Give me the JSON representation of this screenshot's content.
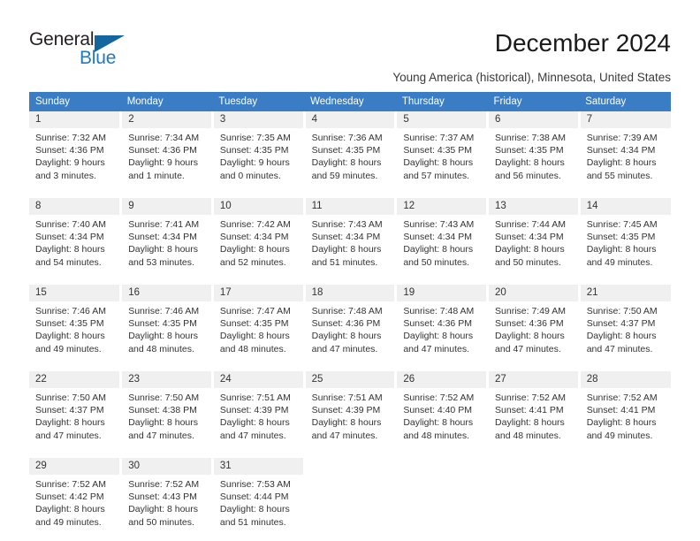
{
  "brand": {
    "name_top": "General",
    "name_bottom": "Blue",
    "color_top": "#231f20",
    "color_bottom": "#1f7ac4",
    "triangle_color": "#15669e"
  },
  "header": {
    "month_title": "December 2024",
    "location": "Young America (historical), Minnesota, United States",
    "header_bg": "#3b7dc4",
    "header_text_color": "#ffffff"
  },
  "weekday_headers": [
    "Sunday",
    "Monday",
    "Tuesday",
    "Wednesday",
    "Thursday",
    "Friday",
    "Saturday"
  ],
  "labels": {
    "sunrise_prefix": "Sunrise:",
    "sunset_prefix": "Sunset:",
    "daylight_prefix": "Daylight:"
  },
  "weeks": [
    [
      {
        "day": "1",
        "sunrise": "Sunrise: 7:32 AM",
        "sunset": "Sunset: 4:36 PM",
        "daylight_line1": "Daylight: 9 hours",
        "daylight_line2": "and 3 minutes."
      },
      {
        "day": "2",
        "sunrise": "Sunrise: 7:34 AM",
        "sunset": "Sunset: 4:36 PM",
        "daylight_line1": "Daylight: 9 hours",
        "daylight_line2": "and 1 minute."
      },
      {
        "day": "3",
        "sunrise": "Sunrise: 7:35 AM",
        "sunset": "Sunset: 4:35 PM",
        "daylight_line1": "Daylight: 9 hours",
        "daylight_line2": "and 0 minutes."
      },
      {
        "day": "4",
        "sunrise": "Sunrise: 7:36 AM",
        "sunset": "Sunset: 4:35 PM",
        "daylight_line1": "Daylight: 8 hours",
        "daylight_line2": "and 59 minutes."
      },
      {
        "day": "5",
        "sunrise": "Sunrise: 7:37 AM",
        "sunset": "Sunset: 4:35 PM",
        "daylight_line1": "Daylight: 8 hours",
        "daylight_line2": "and 57 minutes."
      },
      {
        "day": "6",
        "sunrise": "Sunrise: 7:38 AM",
        "sunset": "Sunset: 4:35 PM",
        "daylight_line1": "Daylight: 8 hours",
        "daylight_line2": "and 56 minutes."
      },
      {
        "day": "7",
        "sunrise": "Sunrise: 7:39 AM",
        "sunset": "Sunset: 4:34 PM",
        "daylight_line1": "Daylight: 8 hours",
        "daylight_line2": "and 55 minutes."
      }
    ],
    [
      {
        "day": "8",
        "sunrise": "Sunrise: 7:40 AM",
        "sunset": "Sunset: 4:34 PM",
        "daylight_line1": "Daylight: 8 hours",
        "daylight_line2": "and 54 minutes."
      },
      {
        "day": "9",
        "sunrise": "Sunrise: 7:41 AM",
        "sunset": "Sunset: 4:34 PM",
        "daylight_line1": "Daylight: 8 hours",
        "daylight_line2": "and 53 minutes."
      },
      {
        "day": "10",
        "sunrise": "Sunrise: 7:42 AM",
        "sunset": "Sunset: 4:34 PM",
        "daylight_line1": "Daylight: 8 hours",
        "daylight_line2": "and 52 minutes."
      },
      {
        "day": "11",
        "sunrise": "Sunrise: 7:43 AM",
        "sunset": "Sunset: 4:34 PM",
        "daylight_line1": "Daylight: 8 hours",
        "daylight_line2": "and 51 minutes."
      },
      {
        "day": "12",
        "sunrise": "Sunrise: 7:43 AM",
        "sunset": "Sunset: 4:34 PM",
        "daylight_line1": "Daylight: 8 hours",
        "daylight_line2": "and 50 minutes."
      },
      {
        "day": "13",
        "sunrise": "Sunrise: 7:44 AM",
        "sunset": "Sunset: 4:34 PM",
        "daylight_line1": "Daylight: 8 hours",
        "daylight_line2": "and 50 minutes."
      },
      {
        "day": "14",
        "sunrise": "Sunrise: 7:45 AM",
        "sunset": "Sunset: 4:35 PM",
        "daylight_line1": "Daylight: 8 hours",
        "daylight_line2": "and 49 minutes."
      }
    ],
    [
      {
        "day": "15",
        "sunrise": "Sunrise: 7:46 AM",
        "sunset": "Sunset: 4:35 PM",
        "daylight_line1": "Daylight: 8 hours",
        "daylight_line2": "and 49 minutes."
      },
      {
        "day": "16",
        "sunrise": "Sunrise: 7:46 AM",
        "sunset": "Sunset: 4:35 PM",
        "daylight_line1": "Daylight: 8 hours",
        "daylight_line2": "and 48 minutes."
      },
      {
        "day": "17",
        "sunrise": "Sunrise: 7:47 AM",
        "sunset": "Sunset: 4:35 PM",
        "daylight_line1": "Daylight: 8 hours",
        "daylight_line2": "and 48 minutes."
      },
      {
        "day": "18",
        "sunrise": "Sunrise: 7:48 AM",
        "sunset": "Sunset: 4:36 PM",
        "daylight_line1": "Daylight: 8 hours",
        "daylight_line2": "and 47 minutes."
      },
      {
        "day": "19",
        "sunrise": "Sunrise: 7:48 AM",
        "sunset": "Sunset: 4:36 PM",
        "daylight_line1": "Daylight: 8 hours",
        "daylight_line2": "and 47 minutes."
      },
      {
        "day": "20",
        "sunrise": "Sunrise: 7:49 AM",
        "sunset": "Sunset: 4:36 PM",
        "daylight_line1": "Daylight: 8 hours",
        "daylight_line2": "and 47 minutes."
      },
      {
        "day": "21",
        "sunrise": "Sunrise: 7:50 AM",
        "sunset": "Sunset: 4:37 PM",
        "daylight_line1": "Daylight: 8 hours",
        "daylight_line2": "and 47 minutes."
      }
    ],
    [
      {
        "day": "22",
        "sunrise": "Sunrise: 7:50 AM",
        "sunset": "Sunset: 4:37 PM",
        "daylight_line1": "Daylight: 8 hours",
        "daylight_line2": "and 47 minutes."
      },
      {
        "day": "23",
        "sunrise": "Sunrise: 7:50 AM",
        "sunset": "Sunset: 4:38 PM",
        "daylight_line1": "Daylight: 8 hours",
        "daylight_line2": "and 47 minutes."
      },
      {
        "day": "24",
        "sunrise": "Sunrise: 7:51 AM",
        "sunset": "Sunset: 4:39 PM",
        "daylight_line1": "Daylight: 8 hours",
        "daylight_line2": "and 47 minutes."
      },
      {
        "day": "25",
        "sunrise": "Sunrise: 7:51 AM",
        "sunset": "Sunset: 4:39 PM",
        "daylight_line1": "Daylight: 8 hours",
        "daylight_line2": "and 47 minutes."
      },
      {
        "day": "26",
        "sunrise": "Sunrise: 7:52 AM",
        "sunset": "Sunset: 4:40 PM",
        "daylight_line1": "Daylight: 8 hours",
        "daylight_line2": "and 48 minutes."
      },
      {
        "day": "27",
        "sunrise": "Sunrise: 7:52 AM",
        "sunset": "Sunset: 4:41 PM",
        "daylight_line1": "Daylight: 8 hours",
        "daylight_line2": "and 48 minutes."
      },
      {
        "day": "28",
        "sunrise": "Sunrise: 7:52 AM",
        "sunset": "Sunset: 4:41 PM",
        "daylight_line1": "Daylight: 8 hours",
        "daylight_line2": "and 49 minutes."
      }
    ],
    [
      {
        "day": "29",
        "sunrise": "Sunrise: 7:52 AM",
        "sunset": "Sunset: 4:42 PM",
        "daylight_line1": "Daylight: 8 hours",
        "daylight_line2": "and 49 minutes."
      },
      {
        "day": "30",
        "sunrise": "Sunrise: 7:52 AM",
        "sunset": "Sunset: 4:43 PM",
        "daylight_line1": "Daylight: 8 hours",
        "daylight_line2": "and 50 minutes."
      },
      {
        "day": "31",
        "sunrise": "Sunrise: 7:53 AM",
        "sunset": "Sunset: 4:44 PM",
        "daylight_line1": "Daylight: 8 hours",
        "daylight_line2": "and 51 minutes."
      },
      {
        "day": "",
        "sunrise": "",
        "sunset": "",
        "daylight_line1": "",
        "daylight_line2": ""
      },
      {
        "day": "",
        "sunrise": "",
        "sunset": "",
        "daylight_line1": "",
        "daylight_line2": ""
      },
      {
        "day": "",
        "sunrise": "",
        "sunset": "",
        "daylight_line1": "",
        "daylight_line2": ""
      },
      {
        "day": "",
        "sunrise": "",
        "sunset": "",
        "daylight_line1": "",
        "daylight_line2": ""
      }
    ]
  ]
}
